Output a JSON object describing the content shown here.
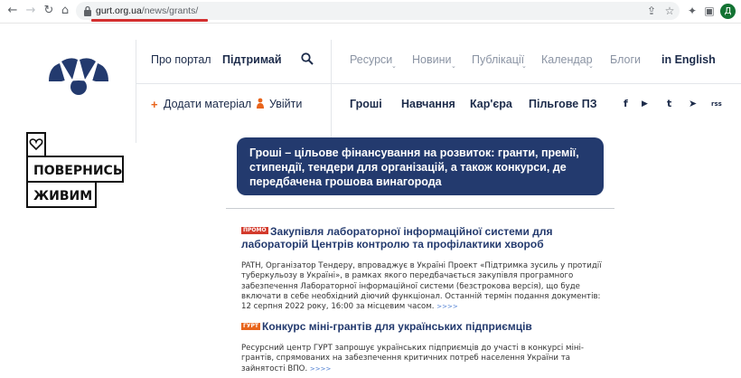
{
  "browser": {
    "url_domain": "gurt.org.ua",
    "url_path": "/news/grants/",
    "avatar_letter": "Д",
    "icons": [
      "back-icon",
      "forward-icon",
      "reload-icon",
      "home-icon",
      "lock-icon",
      "share-icon",
      "star-icon",
      "extensions-icon",
      "sidepanel-icon"
    ]
  },
  "header": {
    "top_nav": {
      "about": "Про портал",
      "support": "Підтримай",
      "resources": "Ресурси",
      "news": "Новини",
      "publications": "Публікації",
      "calendar": "Календар",
      "blogs": "Блоги",
      "english": "in English"
    },
    "sub_nav": {
      "add_material": "Додати матеріал",
      "login": "Увійти",
      "money": "Гроші",
      "education": "Навчання",
      "career": "Кар'єра",
      "software": "Пільгове ПЗ"
    },
    "social": [
      "f",
      "▶",
      "t",
      "➤",
      "rss"
    ]
  },
  "banner": {
    "line1": "ПОВЕРНИСЬ",
    "line2": "ЖИВИМ"
  },
  "page_title": "Гроші – цільове фінансування на розвиток: гранти, премії, стипендії, тендери для організацій, а також конкурси, де передбачена грошова винагорода",
  "articles": [
    {
      "badge": "ПРОМО",
      "title": "Закупівля лабораторної інформаційної системи для лабораторій Центрів контролю та профілактики хвороб",
      "text": "PATH, Організатор Тендеру, впроваджує в Україні Проект «Підтримка зусиль у протидії туберкульозу в Україні», в рамках якого передбачається закупівля програмного забезпечення Лабораторної інформаційної системи (безстрокова версія), що буде включати в себе необхідний діючий функціонал. Останній термін подання документів: 12 серпня 2022 року, 16:00 за місцевим часом.",
      "more": ">>>>"
    },
    {
      "badge": "ГУРТ",
      "title": "Конкурс міні-грантів для українських підприємців",
      "text": "Ресурсний центр ГУРТ запрошує українських підприємців до участі в конкурсі міні-грантів, спрямованих на забезпечення критичних потреб населення України та зайнятості ВПО.",
      "more": ">>>>"
    }
  ],
  "colors": {
    "navy": "#233a6e",
    "accent_orange": "#e8641b",
    "promo_red": "#d33a2c",
    "url_underline": "#d32f2f"
  }
}
